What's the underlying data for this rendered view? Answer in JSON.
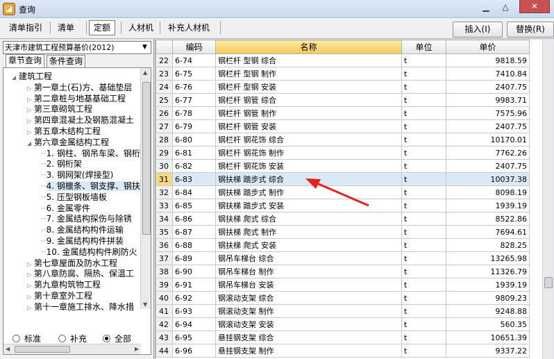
{
  "window": {
    "title": "查询",
    "icon": "app-logo-icon"
  },
  "toolbar": {
    "tabs": [
      "清单指引",
      "清单",
      "定额",
      "人材机",
      "补充人材机"
    ],
    "active_tab": "定额",
    "insert_label": "插入(I)",
    "replace_label": "替换(R)"
  },
  "left": {
    "library": "天津市建筑工程预算基价(2012)",
    "subtabs": [
      "章节查询",
      "条件查询"
    ],
    "tree": [
      {
        "label": "建筑工程",
        "level": 0,
        "expanded": true
      },
      {
        "label": "第一章土(石)方、基础垫层",
        "level": 1
      },
      {
        "label": "第二章桩与地基基础工程",
        "level": 1
      },
      {
        "label": "第三章砌筑工程",
        "level": 1
      },
      {
        "label": "第四章混凝土及钢筋混凝土",
        "level": 1
      },
      {
        "label": "第五章木结构工程",
        "level": 1
      },
      {
        "label": "第六章金属结构工程",
        "level": 1,
        "expanded": true
      },
      {
        "label": "1. 钢柱、钢吊车梁、钢桁",
        "level": 2
      },
      {
        "label": "2. 钢桁架",
        "level": 2
      },
      {
        "label": "3. 钢网架(焊接型)",
        "level": 2
      },
      {
        "label": "4. 钢檩条、钢支撑、钢扶",
        "level": 2,
        "selected": true
      },
      {
        "label": "5. 压型钢板墙板",
        "level": 2
      },
      {
        "label": "6. 金属零件",
        "level": 2
      },
      {
        "label": "7. 金属结构探伤与除锈",
        "level": 2
      },
      {
        "label": "8. 金属结构构件运输",
        "level": 2
      },
      {
        "label": "9. 金属结构构件拼装",
        "level": 2
      },
      {
        "label": "10. 金属结构构件刷防火",
        "level": 2
      },
      {
        "label": "第七章屋面及防水工程",
        "level": 1
      },
      {
        "label": "第八章防腐、隔热、保温工",
        "level": 1
      },
      {
        "label": "第九章构筑物工程",
        "level": 1
      },
      {
        "label": "第十章室外工程",
        "level": 1
      },
      {
        "label": "第十一章施工排水、降水措",
        "level": 1
      }
    ],
    "radios": [
      "标准",
      "补充",
      "全部"
    ],
    "radio_selected": "全部"
  },
  "grid": {
    "headers": [
      "",
      "编码",
      "名称",
      "单位",
      "单价"
    ],
    "rows": [
      {
        "n": "22",
        "code": "6-74",
        "name": "钢栏杆 型钢 综合",
        "unit": "t",
        "price": "9818.59"
      },
      {
        "n": "23",
        "code": "6-75",
        "name": "钢栏杆 型钢 制作",
        "unit": "t",
        "price": "7410.84"
      },
      {
        "n": "24",
        "code": "6-76",
        "name": "钢栏杆 型钢 安装",
        "unit": "t",
        "price": "2407.75"
      },
      {
        "n": "25",
        "code": "6-77",
        "name": "钢栏杆 钢管 综合",
        "unit": "t",
        "price": "9983.71"
      },
      {
        "n": "26",
        "code": "6-78",
        "name": "钢栏杆 钢管 制作",
        "unit": "t",
        "price": "7575.96"
      },
      {
        "n": "27",
        "code": "6-79",
        "name": "钢栏杆 钢管 安装",
        "unit": "t",
        "price": "2407.75"
      },
      {
        "n": "28",
        "code": "6-80",
        "name": "钢栏杆 钢花饰 综合",
        "unit": "t",
        "price": "10170.01"
      },
      {
        "n": "29",
        "code": "6-81",
        "name": "钢栏杆 钢花饰 制作",
        "unit": "t",
        "price": "7762.26"
      },
      {
        "n": "30",
        "code": "6-82",
        "name": "钢栏杆 钢花饰 安装",
        "unit": "t",
        "price": "2407.75"
      },
      {
        "n": "31",
        "code": "6-83",
        "name": "钢扶梯 踏步式 综合",
        "unit": "t",
        "price": "10037.38",
        "selected": true
      },
      {
        "n": "32",
        "code": "6-84",
        "name": "钢扶梯 踏步式 制作",
        "unit": "t",
        "price": "8098.19"
      },
      {
        "n": "33",
        "code": "6-85",
        "name": "钢扶梯 踏步式 安装",
        "unit": "t",
        "price": "1939.19"
      },
      {
        "n": "34",
        "code": "6-86",
        "name": "钢扶梯 爬式 综合",
        "unit": "t",
        "price": "8522.86"
      },
      {
        "n": "35",
        "code": "6-87",
        "name": "钢扶梯 爬式 制作",
        "unit": "t",
        "price": "7694.61"
      },
      {
        "n": "36",
        "code": "6-88",
        "name": "钢扶梯 爬式 安装",
        "unit": "t",
        "price": "828.25"
      },
      {
        "n": "37",
        "code": "6-89",
        "name": "钢吊车梯台 综合",
        "unit": "t",
        "price": "13265.98"
      },
      {
        "n": "38",
        "code": "6-90",
        "name": "钢吊车梯台 制作",
        "unit": "t",
        "price": "11326.79"
      },
      {
        "n": "39",
        "code": "6-91",
        "name": "钢吊车梯台 安装",
        "unit": "t",
        "price": "1939.19"
      },
      {
        "n": "40",
        "code": "6-92",
        "name": "钢滚动支架 综合",
        "unit": "t",
        "price": "9809.23"
      },
      {
        "n": "41",
        "code": "6-93",
        "name": "钢滚动支架 制作",
        "unit": "t",
        "price": "9248.88"
      },
      {
        "n": "42",
        "code": "6-94",
        "name": "钢滚动支架 安装",
        "unit": "t",
        "price": "560.35"
      },
      {
        "n": "43",
        "code": "6-95",
        "name": "悬挂钢支架 综合",
        "unit": "t",
        "price": "10651.39"
      },
      {
        "n": "44",
        "code": "6-96",
        "name": "悬挂钢支架 制作",
        "unit": "t",
        "price": "9337.22"
      }
    ]
  }
}
